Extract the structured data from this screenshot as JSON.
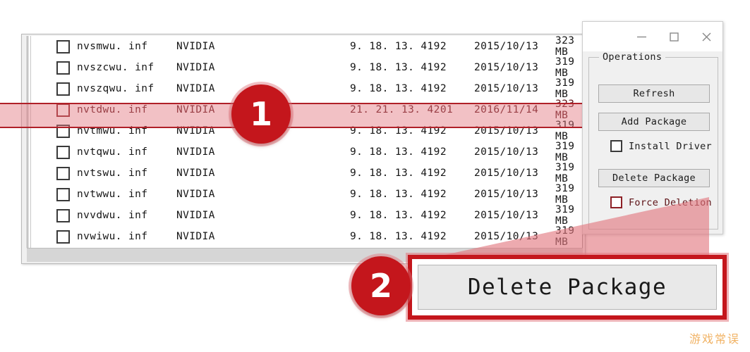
{
  "list_window": {
    "columns": [
      "checkbox",
      "file_name",
      "vendor",
      "version",
      "date",
      "size"
    ],
    "rows": [
      {
        "file": "nvsmwu. inf",
        "vendor": "NVIDIA",
        "version": "9. 18. 13. 4192",
        "date": "2015/10/13",
        "size": "323 MB",
        "selected": false
      },
      {
        "file": "nvszcwu. inf",
        "vendor": "NVIDIA",
        "version": "9. 18. 13. 4192",
        "date": "2015/10/13",
        "size": "319 MB",
        "selected": false
      },
      {
        "file": "nvszqwu. inf",
        "vendor": "NVIDIA",
        "version": "9. 18. 13. 4192",
        "date": "2015/10/13",
        "size": "319 MB",
        "selected": false
      },
      {
        "file": "nvtdwu. inf",
        "vendor": "NVIDIA",
        "version": "21. 21. 13. 4201",
        "date": "2016/11/14",
        "size": "323 MB",
        "selected": true
      },
      {
        "file": "nvtmwu. inf",
        "vendor": "NVIDIA",
        "version": "9. 18. 13. 4192",
        "date": "2015/10/13",
        "size": "319 MB",
        "selected": false
      },
      {
        "file": "nvtqwu. inf",
        "vendor": "NVIDIA",
        "version": "9. 18. 13. 4192",
        "date": "2015/10/13",
        "size": "319 MB",
        "selected": false
      },
      {
        "file": "nvtswu. inf",
        "vendor": "NVIDIA",
        "version": "9. 18. 13. 4192",
        "date": "2015/10/13",
        "size": "319 MB",
        "selected": false
      },
      {
        "file": "nvtwwu. inf",
        "vendor": "NVIDIA",
        "version": "9. 18. 13. 4192",
        "date": "2015/10/13",
        "size": "319 MB",
        "selected": false
      },
      {
        "file": "nvvdwu. inf",
        "vendor": "NVIDIA",
        "version": "9. 18. 13. 4192",
        "date": "2015/10/13",
        "size": "319 MB",
        "selected": false
      },
      {
        "file": "nvwiwu. inf",
        "vendor": "NVIDIA",
        "version": "9. 18. 13. 4192",
        "date": "2015/10/13",
        "size": "319 MB",
        "selected": false
      }
    ]
  },
  "ops_window": {
    "title_bar": {
      "minimize_icon": "minimize-icon",
      "maximize_icon": "maximize-icon",
      "close_icon": "close-icon"
    },
    "group_label": "Operations",
    "refresh_label": "Refresh",
    "add_package_label": "Add Package",
    "install_driver_label": "Install Driver",
    "install_driver_checked": false,
    "delete_package_label": "Delete Package",
    "force_deletion_label": "Force Deletion",
    "force_deletion_checked": false
  },
  "annotations": {
    "badge_1": "1",
    "badge_2": "2",
    "callout_label": "Delete Package",
    "highlight_color": "#e2767e",
    "accent_color": "#c4161c"
  },
  "watermark": "游戏常误"
}
